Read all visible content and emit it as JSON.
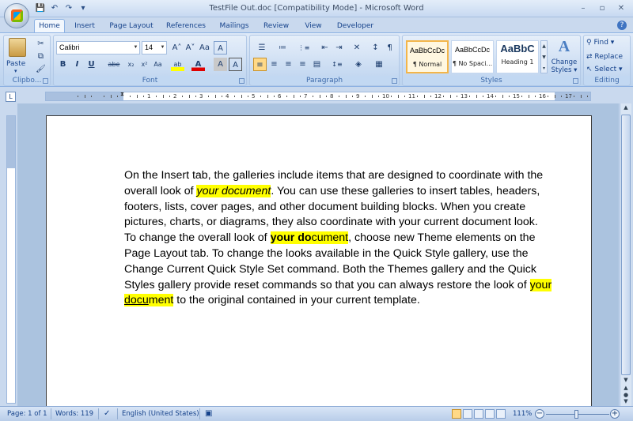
{
  "window": {
    "title": "TestFile Out.doc [Compatibility Mode] - Microsoft Word"
  },
  "quick_access": [
    {
      "icon": "save-icon",
      "glyph": "💾"
    },
    {
      "icon": "undo-icon",
      "glyph": "↶"
    },
    {
      "icon": "redo-icon",
      "glyph": "↷"
    },
    {
      "icon": "customize-icon",
      "glyph": "▾"
    }
  ],
  "window_controls": {
    "minimize": "–",
    "maximize": "▫",
    "close": "✕"
  },
  "tabs": [
    {
      "label": "Home",
      "active": true
    },
    {
      "label": "Insert"
    },
    {
      "label": "Page Layout"
    },
    {
      "label": "References"
    },
    {
      "label": "Mailings"
    },
    {
      "label": "Review"
    },
    {
      "label": "View"
    },
    {
      "label": "Developer"
    }
  ],
  "help_glyph": "?",
  "ribbon": {
    "clipboard": {
      "label": "Clipbo...",
      "paste": "Paste",
      "paste_arrow": "▾",
      "cut": "✂",
      "copy": "⧉",
      "format_painter": "🖌"
    },
    "font": {
      "label": "Font",
      "font_name": "Calibri",
      "font_size": "14",
      "grow": "A˄",
      "shrink": "A˅",
      "clear": "Aa",
      "phonetic": "A",
      "bold": "B",
      "italic": "I",
      "underline": "U",
      "strike": "abe",
      "subscript": "x₂",
      "superscript": "x²",
      "change_case": "Aa",
      "highlight": "ab",
      "font_color": "A",
      "char_shading": "A",
      "char_border": "A"
    },
    "paragraph": {
      "label": "Paragraph",
      "bullets": "☰",
      "numbering": "≔",
      "multilevel": "⋮≡",
      "dec_indent": "⇤",
      "inc_indent": "⇥",
      "sort": "↕",
      "asian_layout": "✕",
      "show_marks": "¶",
      "align_left": "≡",
      "center": "≡",
      "align_right": "≡",
      "justify": "≡",
      "distributed": "▤",
      "line_spacing": "↕≡",
      "shading": "◈",
      "borders": "▦"
    },
    "styles": {
      "label": "Styles",
      "items": [
        {
          "preview": "AaBbCcDc",
          "name": "¶ Normal",
          "selected": true
        },
        {
          "preview": "AaBbCcDc",
          "name": "¶ No Spaci..."
        },
        {
          "preview": "AaBbC",
          "name": "Heading 1"
        }
      ],
      "change_styles": "Change Styles",
      "change_styles_arrow": "▾"
    },
    "editing": {
      "label": "Editing",
      "find": "Find",
      "replace": "Replace",
      "select": "Select"
    }
  },
  "ruler": {
    "tab_selector": "L",
    "numbers": [
      "1",
      "2",
      "3",
      "4",
      "5",
      "6",
      "7",
      "8",
      "9",
      "10",
      "11",
      "12",
      "13",
      "14",
      "15",
      "16",
      "17"
    ]
  },
  "document": {
    "p1": {
      "a": "On the Insert tab, the galleries include items that are designed to coordinate with the overall look of ",
      "b": "your document",
      "c": ". You can use these galleries to insert tables, headers, footers, lists, cover pages, and other document building blocks. When you create pictures, charts, or diagrams, they also coordinate with your current document look."
    },
    "p2": {
      "a": "To change the overall look of ",
      "b1": "your do",
      "b2": "cument",
      "c": ", choose new Theme elements on the Page Layout tab. To change the looks available in the Quick Style gallery, use the Change Current Quick Style Set command. Both the Themes gallery and the Quick Styles gallery provide reset  commands so that you can always restore the look of ",
      "d1": "your ",
      "d2": "docu",
      "d3": "ment",
      "e": " to the original contained in your current template."
    }
  },
  "scrollbar": {
    "up": "▲",
    "down": "▼",
    "prev_page": "▲",
    "select_browse": "●",
    "next_page": "▼"
  },
  "status": {
    "page": "Page: 1 of 1",
    "words": "Words: 119",
    "proofing_icon": "✓",
    "language": "English (United States)",
    "macro_icon": "▣",
    "zoom": "111%",
    "zoom_out": "−",
    "zoom_in": "+"
  }
}
